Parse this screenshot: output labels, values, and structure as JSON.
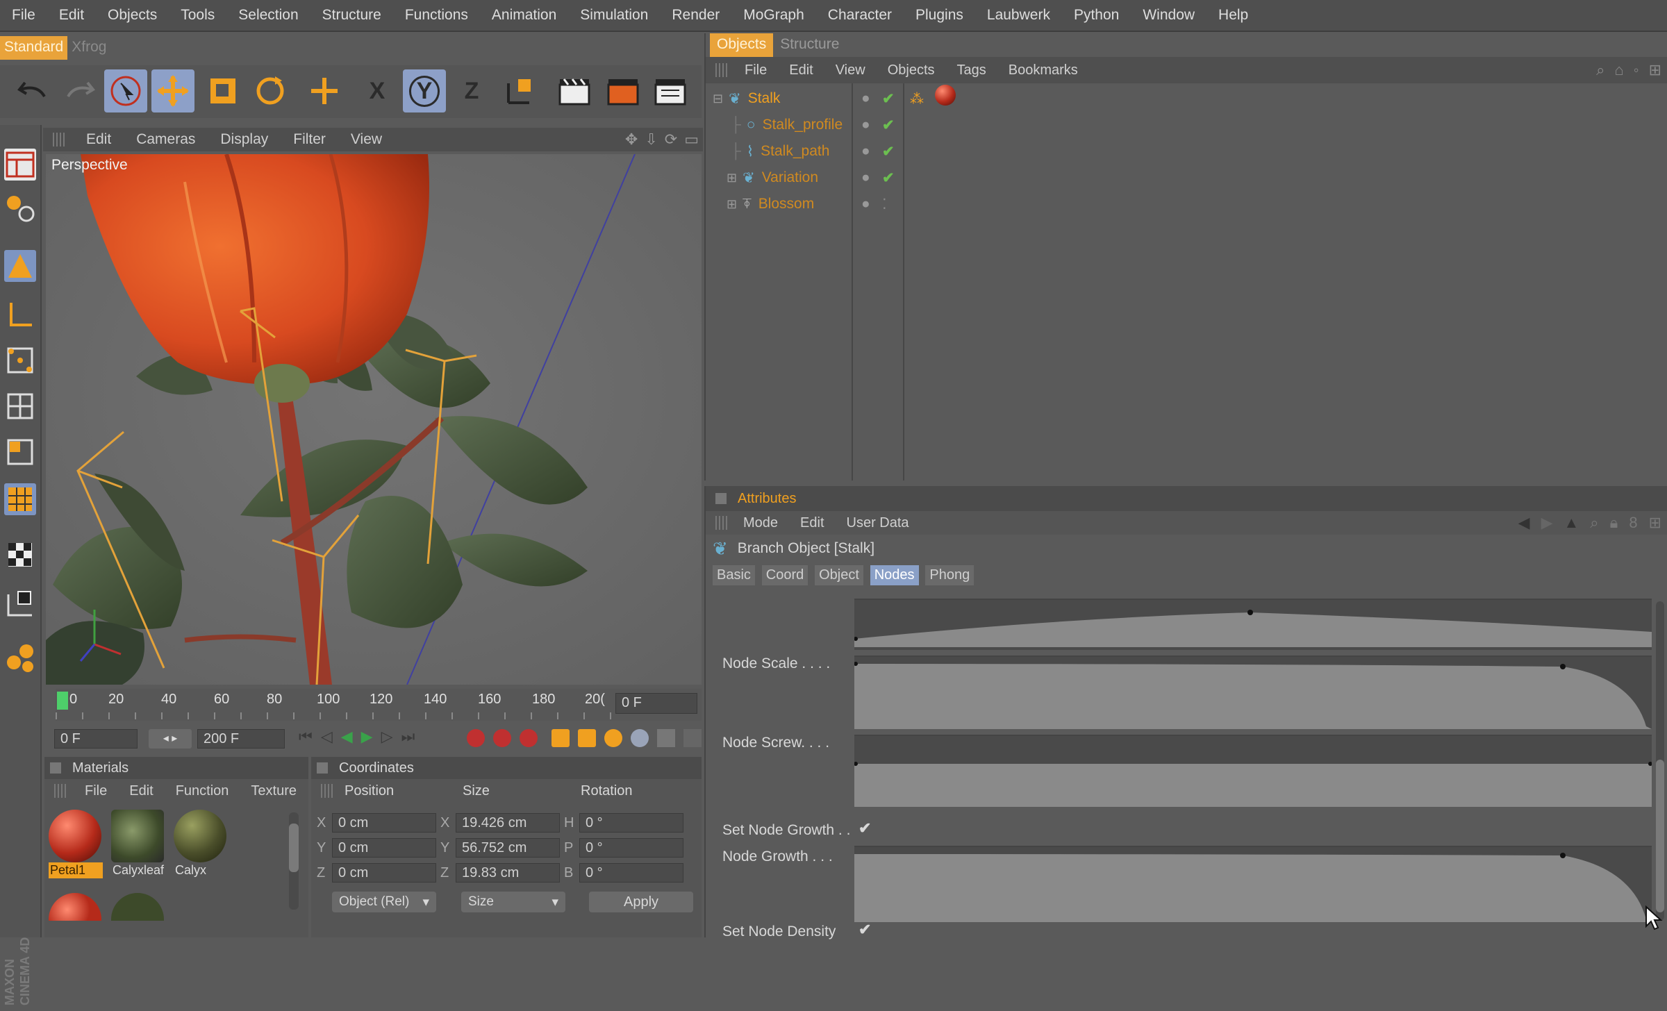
{
  "menu": [
    "File",
    "Edit",
    "Objects",
    "Tools",
    "Selection",
    "Structure",
    "Functions",
    "Animation",
    "Simulation",
    "Render",
    "MoGraph",
    "Character",
    "Plugins",
    "Laubwerk",
    "Python",
    "Window",
    "Help"
  ],
  "layout_tabs": [
    "Standard",
    "Xfrog"
  ],
  "toolbar": {
    "x_label": "X",
    "y_label": "Y",
    "z_label": "Z"
  },
  "viewport": {
    "menu": [
      "Edit",
      "Cameras",
      "Display",
      "Filter",
      "View"
    ],
    "label": "Perspective"
  },
  "timeline": {
    "ticks": [
      "0",
      "20",
      "40",
      "60",
      "80",
      "100",
      "120",
      "140",
      "160",
      "180",
      "20("
    ],
    "current_frame": "0 F",
    "start_frame": "0 F",
    "end_frame": "200 F"
  },
  "materials": {
    "title": "Materials",
    "menu": [
      "File",
      "Edit",
      "Function",
      "Texture"
    ],
    "items": [
      {
        "label": "Petal1",
        "color": "#b52a1a"
      },
      {
        "label": "Calyxleaf",
        "color": "#5c6b40"
      },
      {
        "label": "Calyx",
        "color": "#5a5a36"
      }
    ]
  },
  "coordinates": {
    "title": "Coordinates",
    "headers": [
      "Position",
      "Size",
      "Rotation"
    ],
    "rows": [
      {
        "axis": "X",
        "pos": "0 cm",
        "size_axis": "X",
        "size": "19.426 cm",
        "rot_axis": "H",
        "rot": "0 °"
      },
      {
        "axis": "Y",
        "pos": "0 cm",
        "size_axis": "Y",
        "size": "56.752 cm",
        "rot_axis": "P",
        "rot": "0 °"
      },
      {
        "axis": "Z",
        "pos": "0 cm",
        "size_axis": "Z",
        "size": "19.83 cm",
        "rot_axis": "B",
        "rot": "0 °"
      }
    ],
    "mode_select": "Object (Rel)",
    "size_select": "Size",
    "apply_label": "Apply"
  },
  "objects_panel": {
    "tabs": [
      "Objects",
      "Structure"
    ],
    "menu": [
      "File",
      "Edit",
      "View",
      "Objects",
      "Tags",
      "Bookmarks"
    ],
    "items": [
      {
        "name": "Stalk"
      },
      {
        "name": "Stalk_profile"
      },
      {
        "name": "Stalk_path"
      },
      {
        "name": "Variation"
      },
      {
        "name": "Blossom"
      }
    ]
  },
  "attributes": {
    "title": "Attributes",
    "menu": [
      "Mode",
      "Edit",
      "User Data"
    ],
    "object_title": "Branch Object [Stalk]",
    "tabs": [
      "Basic",
      "Coord",
      "Object",
      "Nodes",
      "Phong"
    ],
    "active_tab": "Nodes",
    "params": {
      "node_scale": "Node Scale . . . .",
      "node_screw": "Node Screw. . . .",
      "set_node_growth": "Set Node Growth . .",
      "node_growth": "Node Growth . . .",
      "set_node_density": "Set Node Density"
    }
  },
  "brand": "MAXON CINEMA 4D"
}
